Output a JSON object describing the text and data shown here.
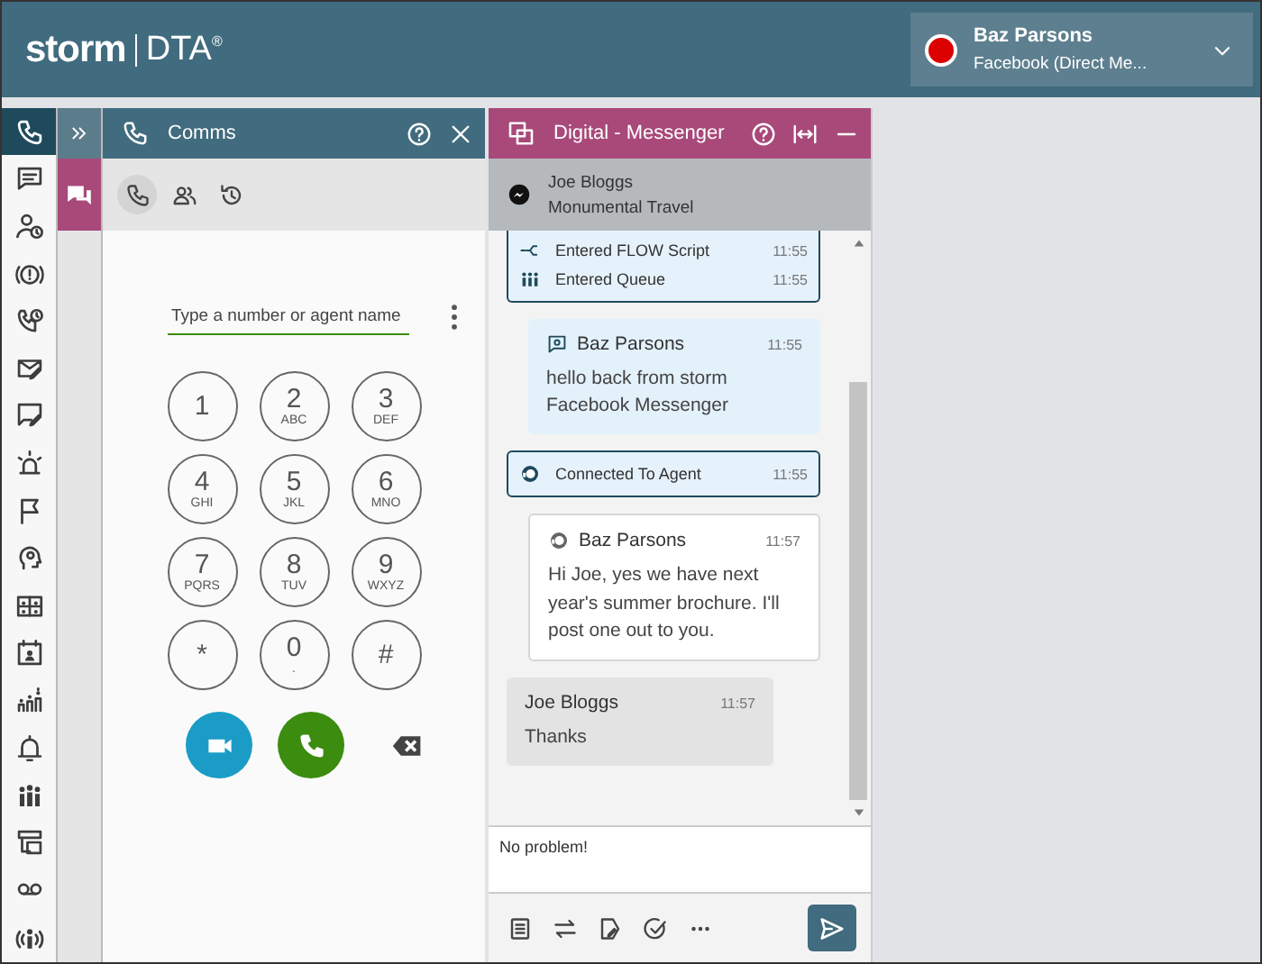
{
  "header": {
    "logo_word": "storm",
    "logo_product": "DTA$^{®}$",
    "user": {
      "name": "Baz Parsons",
      "busy": true,
      "channel": "Facebook (Direct Me..."
    }
  },
  "sidebar": {
    "items": [
      {
        "selected": true
      },
      {
        "selected": false
      },
      {
        "selected": false
      },
      {
        "selected": false
      },
      {
        "selected": false
      },
      {
        "selected": false
      },
      {
        "selected": false
      },
      {
        "selected": false
      },
      {
        "selected": false
      },
      {
        "selected": false
      },
      {
        "selected": false
      },
      {
        "selected": false
      },
      {
        "selected": false
      },
      {
        "selected": false
      },
      {
        "selected": false
      },
      {
        "selected": false
      },
      {
        "selected": false
      },
      {
        "selected": false
      }
    ]
  },
  "dock": {
    "items": [
      {
        "selected": true
      }
    ]
  },
  "comms": {
    "title": "Comms",
    "tabs": [
      {
        "selected": true
      },
      {
        "selected": false
      },
      {
        "selected": false
      }
    ],
    "search": {
      "placeholder": "Type a number or agent name"
    },
    "keys": [
      {
        "digit": "1"
      },
      {
        "digit": "2",
        "letters": "ABC"
      },
      {
        "digit": "3",
        "letters": "DEF"
      },
      {
        "digit": "4",
        "letters": "GHI"
      },
      {
        "digit": "5",
        "letters": "JKL"
      },
      {
        "digit": "6",
        "letters": "MNO"
      },
      {
        "digit": "7",
        "letters": "PQRS"
      },
      {
        "digit": "8",
        "letters": "TUV"
      },
      {
        "digit": "9",
        "letters": "WXYZ"
      },
      {
        "digit": "*"
      },
      {
        "digit": "0",
        "letters": "."
      },
      {
        "digit": "#"
      }
    ]
  },
  "messenger": {
    "title": "Digital - Messenger",
    "contact": {
      "name": "Joe Bloggs",
      "company": "Monumental Travel"
    },
    "messages": [
      {
        "kind": "events",
        "rows": [
          {
            "kind": "flow",
            "text": "Entered FLOW Script",
            "time": "11:55"
          },
          {
            "kind": "queue",
            "text": "Entered Queue",
            "time": "11:55"
          }
        ]
      },
      {
        "kind": "bot",
        "sender": "Baz Parsons",
        "time": "11:55",
        "text": "hello back from storm Facebook Messenger"
      },
      {
        "kind": "connected",
        "text": "Connected To Agent",
        "time": "11:55"
      },
      {
        "kind": "agent",
        "sender": "Baz Parsons",
        "time": "11:57",
        "text": "Hi Joe, yes we have next year's summer brochure. I'll post one out to you."
      },
      {
        "kind": "customer",
        "sender": "Joe Bloggs",
        "time": "11:57",
        "text": "Thanks"
      }
    ],
    "composer": {
      "value": "No problem!"
    }
  }
}
